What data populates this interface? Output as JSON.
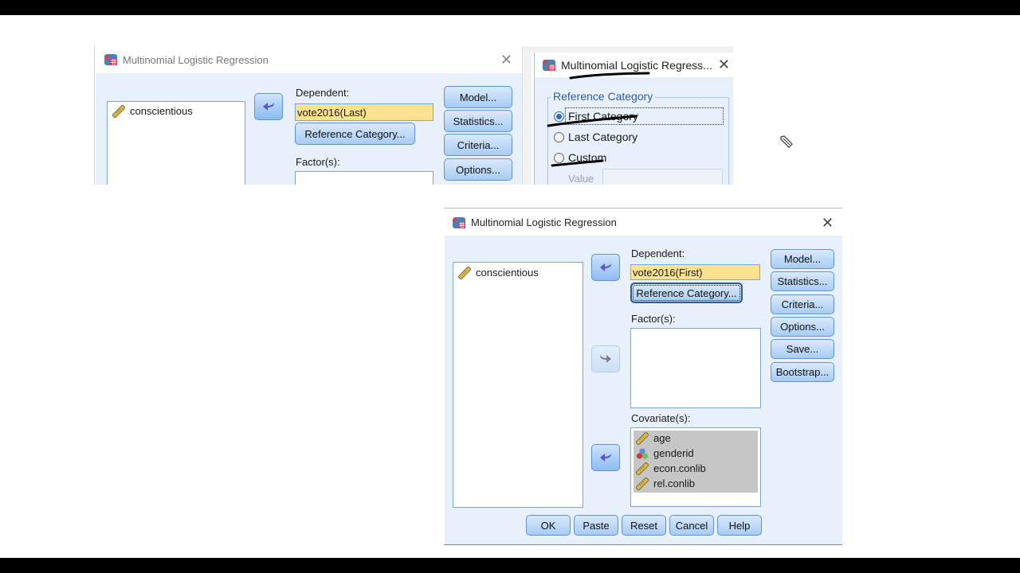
{
  "colors": {
    "dialog_bg": "#e8f1fb",
    "dependent_field_bg": "#fbe28e",
    "button_border": "#5f93d1",
    "group_legend": "#2a5ea8",
    "ink_annotation": "#000000"
  },
  "dialog_top_left": {
    "title": "Multinomial Logistic Regression",
    "close_icon": "close-icon",
    "source_variables": [
      {
        "name": "conscientious",
        "icon": "scale-ruler-icon"
      }
    ],
    "dependent_label": "Dependent:",
    "dependent_value": "vote2016(Last)",
    "reference_category_button": "Reference Category...",
    "factors_label": "Factor(s):",
    "side_buttons": [
      "Model...",
      "Statistics...",
      "Criteria...",
      "Options..."
    ]
  },
  "dialog_reference_category": {
    "title": "Multinomial Logistic Regress...",
    "close_icon": "close-icon",
    "group_label": "Reference Category",
    "options": [
      {
        "label": "First Category",
        "selected": true
      },
      {
        "label": "Last Category",
        "selected": false
      },
      {
        "label": "Custom",
        "selected": false
      }
    ],
    "value_label": "Value",
    "value_input": ""
  },
  "dialog_main": {
    "title": "Multinomial Logistic Regression",
    "close_icon": "close-icon",
    "source_variables": [
      {
        "name": "conscientious",
        "icon": "scale-ruler-icon"
      }
    ],
    "dependent_label": "Dependent:",
    "dependent_value": "vote2016(First)",
    "reference_category_button": "Reference Category...",
    "factors_label": "Factor(s):",
    "factors": [],
    "covariates_label": "Covariate(s):",
    "covariates": [
      {
        "name": "age",
        "icon": "scale-ruler-icon"
      },
      {
        "name": "genderid",
        "icon": "nominal-circles-icon"
      },
      {
        "name": "econ.conlib",
        "icon": "scale-ruler-icon"
      },
      {
        "name": "rel.conlib",
        "icon": "scale-ruler-icon"
      }
    ],
    "side_buttons": [
      "Model...",
      "Statistics...",
      "Criteria...",
      "Options...",
      "Save...",
      "Bootstrap..."
    ],
    "bottom_buttons": [
      "OK",
      "Paste",
      "Reset",
      "Cancel",
      "Help"
    ]
  }
}
